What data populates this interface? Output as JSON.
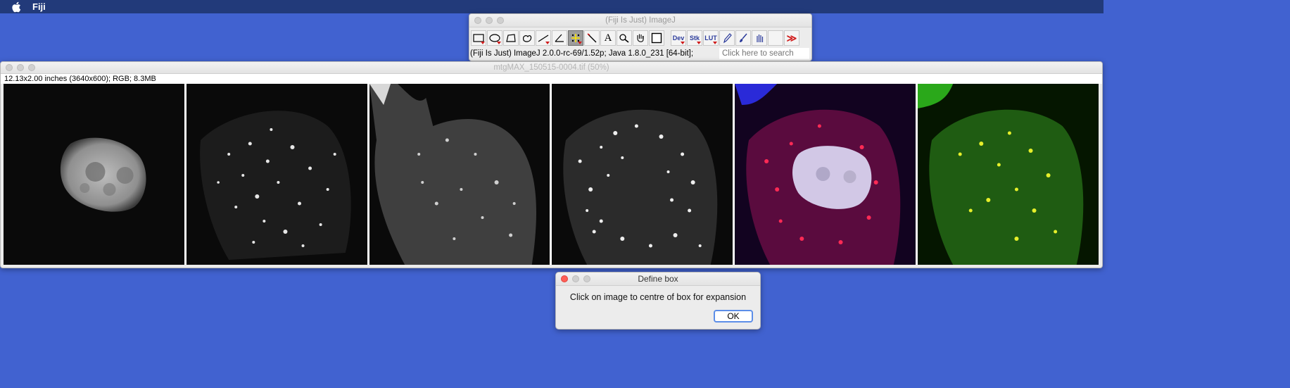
{
  "menubar": {
    "app_name": "Fiji"
  },
  "imagej": {
    "title": "(Fiji Is Just) ImageJ",
    "status": "(Fiji Is Just) ImageJ 2.0.0-rc-69/1.52p; Java 1.8.0_231 [64-bit];",
    "search_placeholder": "Click here to search",
    "tools": {
      "text_tool": "A",
      "dev": "Dev",
      "stk": "Stk",
      "lut": "LUT",
      "more": "≫"
    }
  },
  "image_window": {
    "title": "mtgMAX_150515-0004.tif (50%)",
    "info": "12.13x2.00 inches (3640x600); RGB; 8.3MB"
  },
  "dialog": {
    "title": "Define box",
    "message": "Click on image to centre of box for expansion",
    "ok_label": "OK"
  },
  "colors": {
    "desktop": "#4162d0",
    "menubar": "#223a7a",
    "selected_tool": "#9c9c9c"
  }
}
